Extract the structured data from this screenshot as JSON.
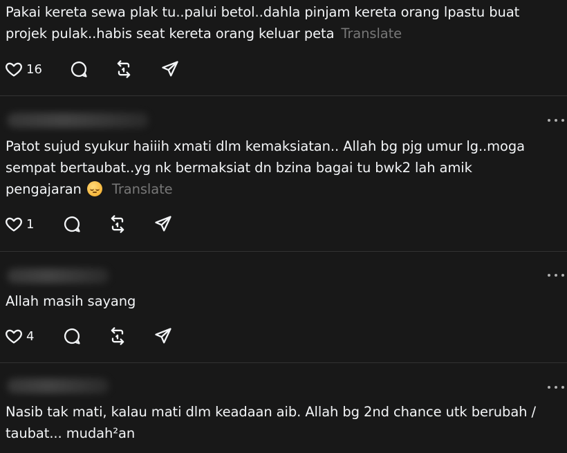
{
  "posts": [
    {
      "text": "Pakai kereta sewa plak tu..palui betol..dahla pinjam kereta orang lpastu buat projek pulak..habis seat kereta orang keluar peta",
      "translate_label": "Translate",
      "likes": "16"
    },
    {
      "text": "Patot sujud syukur haiiih xmati dlm kemaksiatan.. Allah bg pjg umur lg..moga sempat bertaubat..yg nk bermaksiat dn bzina bagai tu bwk2 lah amik pengajaran",
      "emoji": "relieved-face-emoji",
      "translate_label": "Translate",
      "likes": "1"
    },
    {
      "text": "Allah masih sayang",
      "likes": "4"
    },
    {
      "text": "Nasib tak mati, kalau mati dlm keadaan aib. Allah bg 2nd chance utk berubah / taubat... mudah²an"
    }
  ],
  "icons": {
    "like": "heart-icon",
    "reply": "comment-bubble-icon",
    "repost": "repost-icon",
    "share": "send-icon",
    "more": "more-dots-icon"
  },
  "colors": {
    "background": "#181818",
    "text": "#f3f5f7",
    "muted": "#777777",
    "divider": "#333333"
  }
}
